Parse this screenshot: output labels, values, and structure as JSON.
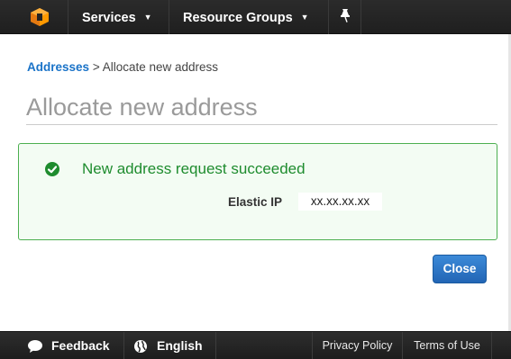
{
  "header": {
    "logo_icon": "aws-cube-icon",
    "services_label": "Services",
    "resource_groups_label": "Resource Groups",
    "pin_icon": "pin-icon"
  },
  "breadcrumb": {
    "parent": "Addresses",
    "separator": ">",
    "current": "Allocate new address"
  },
  "page": {
    "title": "Allocate new address"
  },
  "success": {
    "icon": "check-circle-icon",
    "message": "New address request succeeded",
    "ip_label": "Elastic IP",
    "ip_value": "xx.xx.xx.xx",
    "color": "#1e8c2e"
  },
  "actions": {
    "close_label": "Close"
  },
  "footer": {
    "feedback_label": "Feedback",
    "language_label": "English",
    "privacy_label": "Privacy Policy",
    "terms_label": "Terms of Use"
  },
  "colors": {
    "nav_bg": "#232323",
    "link": "#1a73c8",
    "button": "#2a72c5"
  }
}
